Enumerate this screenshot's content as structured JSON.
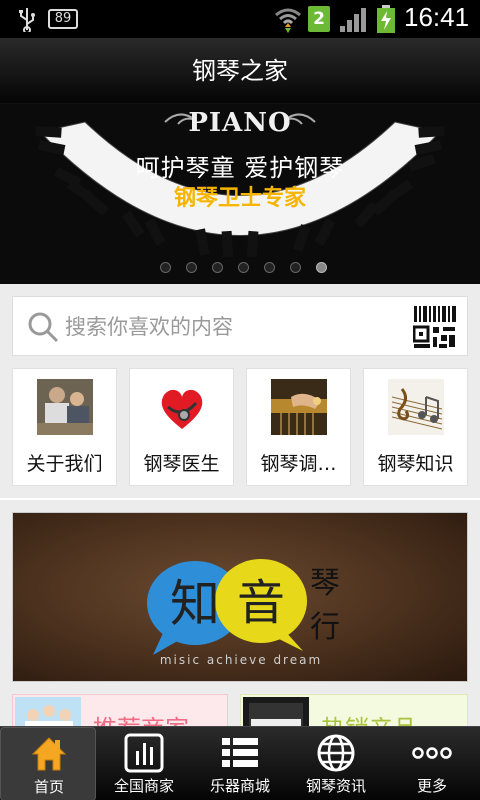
{
  "status_bar": {
    "battery_left": "89",
    "sim_badge": "2",
    "time": "16:41"
  },
  "header": {
    "title": "钢琴之家"
  },
  "banner": {
    "brand_text": "PIANO",
    "slogan_line1": "呵护琴童  爱护钢琴",
    "slogan_line2": "钢琴卫士专家",
    "dots_count": 7,
    "active_dot": 6
  },
  "search": {
    "placeholder": "搜索你喜欢的内容"
  },
  "quick_links": [
    {
      "label": "关于我们",
      "icon": "people-meeting-image"
    },
    {
      "label": "钢琴医生",
      "icon": "stethoscope-heart-image"
    },
    {
      "label": "钢琴调…",
      "icon": "piano-tuning-image"
    },
    {
      "label": "钢琴知识",
      "icon": "music-notes-image"
    }
  ],
  "feature": {
    "logo_chars": [
      "知",
      "音",
      "琴",
      "行"
    ],
    "slogan": "misic achieve dream"
  },
  "cards": [
    {
      "text": "推荐商家",
      "color": "#f26b85"
    },
    {
      "text": "热销产品",
      "color": "#a9c33d"
    }
  ],
  "tabs": [
    {
      "label": "首页",
      "icon": "home-icon",
      "active": true
    },
    {
      "label": "全国商家",
      "icon": "bar-chart-icon",
      "active": false
    },
    {
      "label": "乐器商城",
      "icon": "list-icon",
      "active": false
    },
    {
      "label": "钢琴资讯",
      "icon": "globe-icon",
      "active": false
    },
    {
      "label": "更多",
      "icon": "more-dots-icon",
      "active": false
    }
  ],
  "colors": {
    "accent_gold": "#f7b500",
    "home_icon": "#f5a623"
  }
}
